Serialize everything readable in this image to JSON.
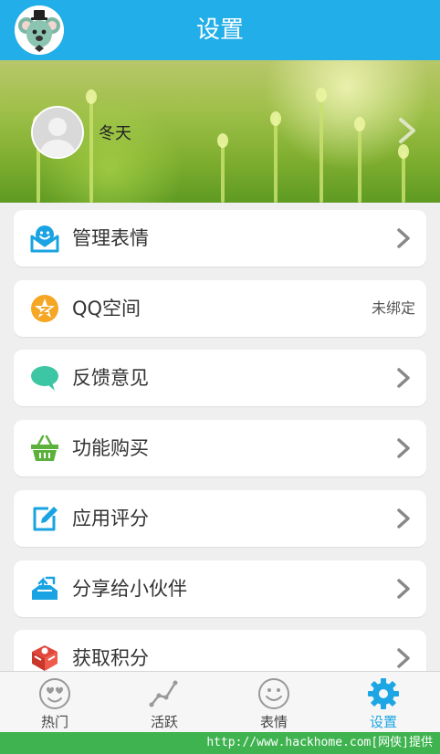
{
  "header": {
    "title": "设置"
  },
  "profile": {
    "name": "冬天"
  },
  "menu": [
    {
      "label": "管理表情",
      "icon": "emoji-manage-icon",
      "has_chevron": true
    },
    {
      "label": "QQ空间",
      "icon": "qq-zone-icon",
      "status": "未绑定"
    },
    {
      "label": "反馈意见",
      "icon": "feedback-bubble-icon",
      "has_chevron": true
    },
    {
      "label": "功能购买",
      "icon": "shopping-basket-icon",
      "has_chevron": true
    },
    {
      "label": "应用评分",
      "icon": "edit-rate-icon",
      "has_chevron": true
    },
    {
      "label": "分享给小伙伴",
      "icon": "share-icon",
      "has_chevron": true
    },
    {
      "label": "获取积分",
      "icon": "gift-box-icon",
      "has_chevron": true
    }
  ],
  "tabs": [
    {
      "label": "热门",
      "icon": "love-face-icon",
      "active": false
    },
    {
      "label": "活跃",
      "icon": "trend-line-icon",
      "active": false
    },
    {
      "label": "表情",
      "icon": "smile-face-icon",
      "active": false
    },
    {
      "label": "设置",
      "icon": "gear-icon",
      "active": true
    }
  ],
  "footer": {
    "text": "http://www.hackhome.com[网侠]提供"
  },
  "colors": {
    "header_blue": "#22aee8",
    "active_tab": "#1da6e4",
    "footer_green": "#3fb34f"
  }
}
